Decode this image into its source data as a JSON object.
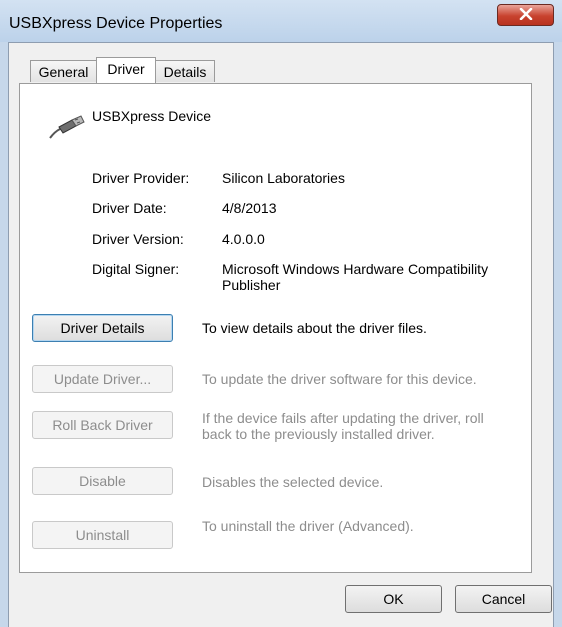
{
  "window": {
    "title": "USBXpress Device Properties",
    "close_icon": "close-icon"
  },
  "tabs": [
    {
      "label": "General",
      "active": false
    },
    {
      "label": "Driver",
      "active": true
    },
    {
      "label": "Details",
      "active": false
    }
  ],
  "device": {
    "icon": "usb-cable-icon",
    "name": "USBXpress Device"
  },
  "driver_info": {
    "provider_label": "Driver Provider:",
    "provider_value": "Silicon Laboratories",
    "date_label": "Driver Date:",
    "date_value": "4/8/2013",
    "version_label": "Driver Version:",
    "version_value": "4.0.0.0",
    "signer_label": "Digital Signer:",
    "signer_value": "Microsoft Windows Hardware Compatibility Publisher"
  },
  "actions": {
    "details": {
      "label": "Driver Details",
      "description": "To view details about the driver files.",
      "enabled": true
    },
    "update": {
      "label": "Update Driver...",
      "description": "To update the driver software for this device.",
      "enabled": false
    },
    "rollback": {
      "label": "Roll Back Driver",
      "description": "If the device fails after updating the driver, roll back to the previously installed driver.",
      "enabled": false
    },
    "disable": {
      "label": "Disable",
      "description": "Disables the selected device.",
      "enabled": false
    },
    "uninstall": {
      "label": "Uninstall",
      "description": "To uninstall the driver (Advanced).",
      "enabled": false
    }
  },
  "footer": {
    "ok_label": "OK",
    "cancel_label": "Cancel"
  }
}
